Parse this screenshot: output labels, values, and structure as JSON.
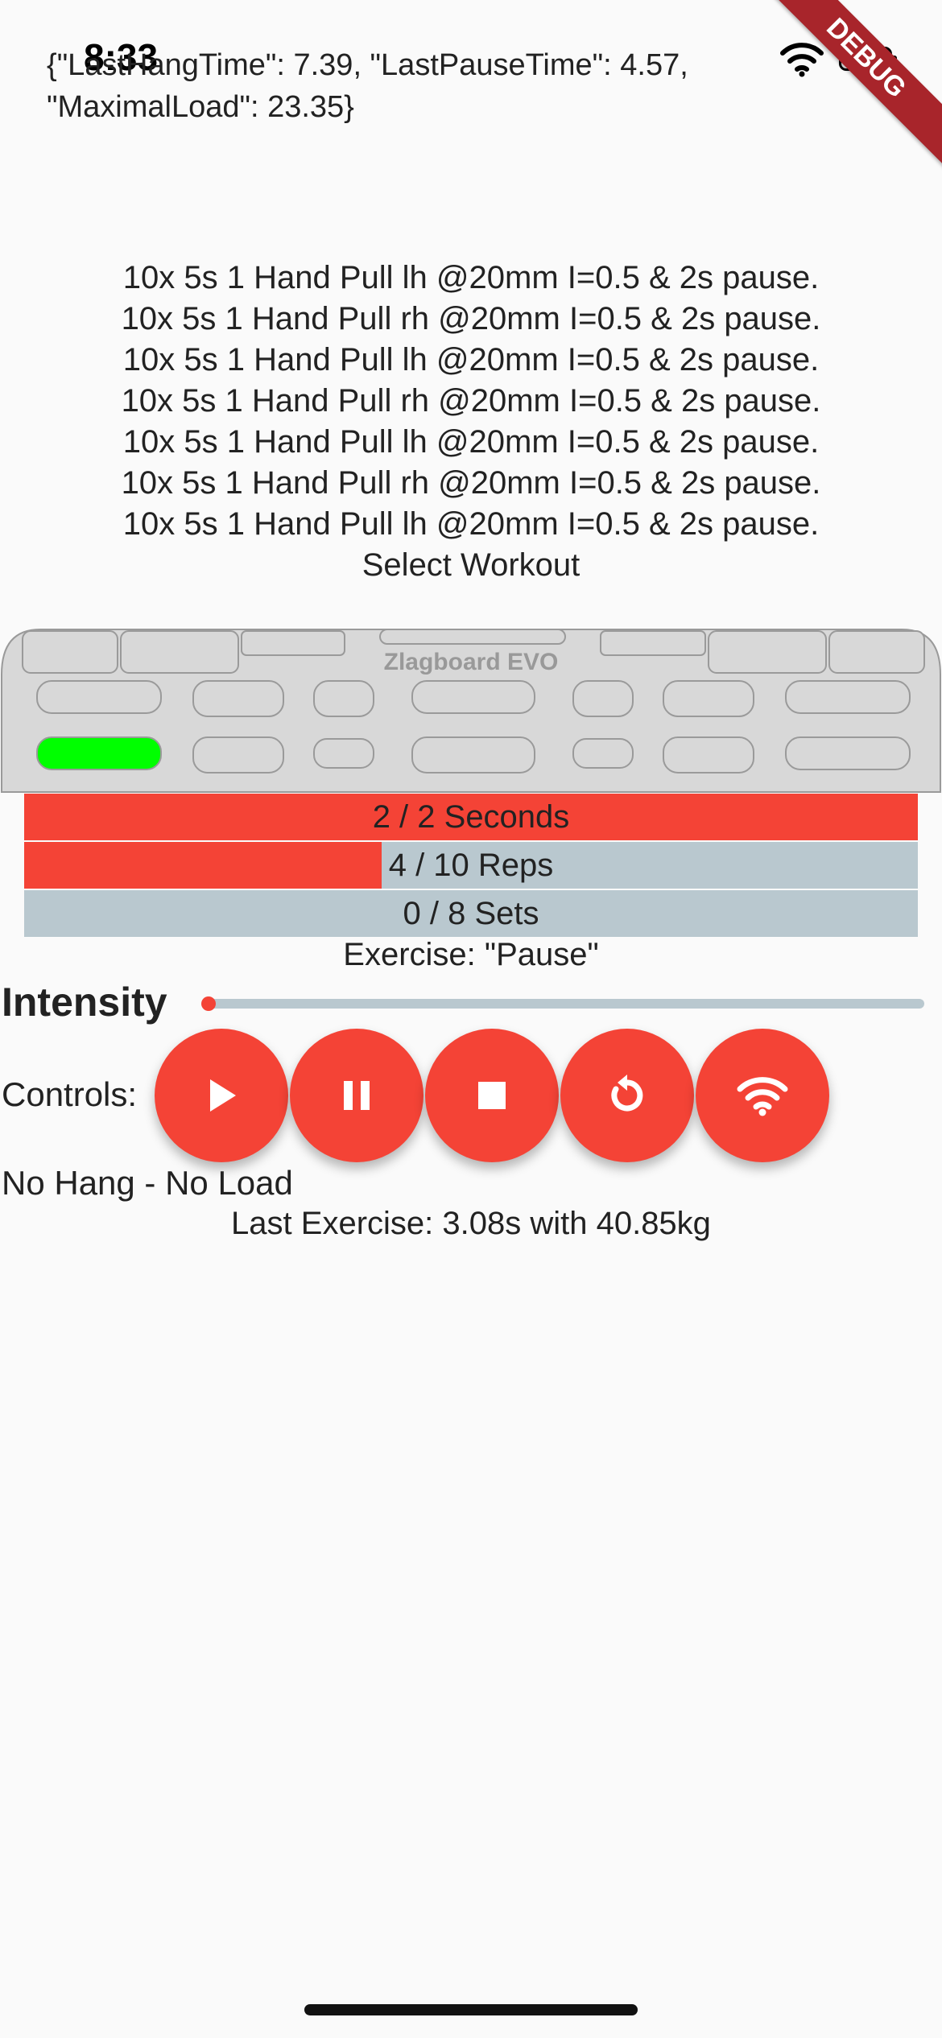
{
  "status_bar": {
    "time": "8:33"
  },
  "debug_banner": "DEBUG",
  "stats_json": {
    "line1": "{\"LastHangTime\": 7.39, \"LastPauseTime\": 4.57,",
    "line2": "\"MaximalLoad\": 23.35}"
  },
  "workouts": [
    "10x 5s 1 Hand Pull lh @20mm I=0.5 & 2s pause.",
    "10x 5s 1 Hand Pull rh @20mm I=0.5 & 2s pause.",
    "10x 5s 1 Hand Pull lh @20mm I=0.5 & 2s pause.",
    "10x 5s 1 Hand Pull rh @20mm I=0.5 & 2s pause.",
    "10x 5s 1 Hand Pull lh @20mm I=0.5 & 2s pause.",
    "10x 5s 1 Hand Pull rh @20mm I=0.5 & 2s pause.",
    "10x 5s 1 Hand Pull lh @20mm I=0.5 & 2s pause."
  ],
  "select_workout_label": "Select Workout",
  "board": {
    "name": "Zlagboard EVO",
    "active_hold_color": "#00ff00"
  },
  "progress": {
    "seconds": {
      "label": "2 / 2 Seconds",
      "fraction": 1.0
    },
    "reps": {
      "label": "4 / 10 Reps",
      "fraction": 0.4
    },
    "sets": {
      "label": "0 / 8 Sets",
      "fraction": 0.0
    }
  },
  "exercise_label": "Exercise: \"Pause\"",
  "intensity": {
    "label": "Intensity",
    "value": 0.0
  },
  "controls": {
    "label": "Controls:",
    "buttons": [
      {
        "name": "play-button",
        "icon": "play-icon"
      },
      {
        "name": "pause-button",
        "icon": "pause-icon"
      },
      {
        "name": "stop-button",
        "icon": "stop-icon"
      },
      {
        "name": "reset-button",
        "icon": "reset-icon"
      },
      {
        "name": "connect-button",
        "icon": "wifi-icon"
      }
    ]
  },
  "hang_status": "No Hang - No Load",
  "last_exercise": "Last Exercise: 3.08s with 40.85kg",
  "colors": {
    "accent": "#f44336",
    "track": "#b9c8cf",
    "background": "#fafafa"
  }
}
